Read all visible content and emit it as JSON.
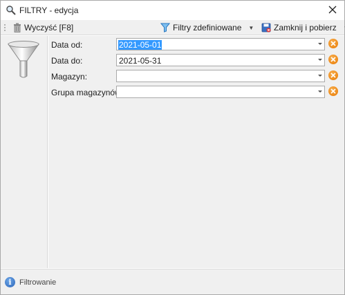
{
  "window": {
    "title": "FILTRY - edycja",
    "close_glyph": "✕"
  },
  "toolbar": {
    "clear_label": "Wyczyść [F8]",
    "defined_filters_label": "Filtry zdefiniowane",
    "defined_filters_arrow": "▼",
    "close_fetch_label": "Zamknij i pobierz",
    "close_fetch_arrow": "▼"
  },
  "form": {
    "fields": [
      {
        "label": "Data od:",
        "value": "2021-05-01",
        "selected": true
      },
      {
        "label": "Data do:",
        "value": "2021-05-31",
        "selected": false
      },
      {
        "label": "Magazyn:",
        "value": "",
        "selected": false
      },
      {
        "label": "Grupa magazynów:",
        "value": "",
        "selected": false
      }
    ]
  },
  "statusbar": {
    "info_glyph": "i",
    "text": "Filtrowanie"
  },
  "colors": {
    "accent_selection": "#3399ff",
    "clear_orange": "#e87800",
    "info_blue": "#2a64b8"
  }
}
